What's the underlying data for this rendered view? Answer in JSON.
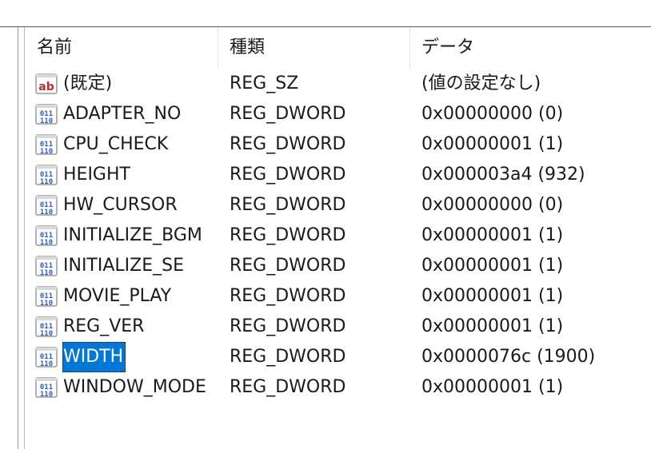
{
  "columns": {
    "name": "名前",
    "type": "種類",
    "data": "データ"
  },
  "rows": [
    {
      "icon": "string-value-icon",
      "name": "(既定)",
      "type": "REG_SZ",
      "data": "(値の設定なし)",
      "selected": false
    },
    {
      "icon": "binary-value-icon",
      "name": "ADAPTER_NO",
      "type": "REG_DWORD",
      "data": "0x00000000 (0)",
      "selected": false
    },
    {
      "icon": "binary-value-icon",
      "name": "CPU_CHECK",
      "type": "REG_DWORD",
      "data": "0x00000001 (1)",
      "selected": false
    },
    {
      "icon": "binary-value-icon",
      "name": "HEIGHT",
      "type": "REG_DWORD",
      "data": "0x000003a4 (932)",
      "selected": false
    },
    {
      "icon": "binary-value-icon",
      "name": "HW_CURSOR",
      "type": "REG_DWORD",
      "data": "0x00000000 (0)",
      "selected": false
    },
    {
      "icon": "binary-value-icon",
      "name": "INITIALIZE_BGM",
      "type": "REG_DWORD",
      "data": "0x00000001 (1)",
      "selected": false
    },
    {
      "icon": "binary-value-icon",
      "name": "INITIALIZE_SE",
      "type": "REG_DWORD",
      "data": "0x00000001 (1)",
      "selected": false
    },
    {
      "icon": "binary-value-icon",
      "name": "MOVIE_PLAY",
      "type": "REG_DWORD",
      "data": "0x00000001 (1)",
      "selected": false
    },
    {
      "icon": "binary-value-icon",
      "name": "REG_VER",
      "type": "REG_DWORD",
      "data": "0x00000001 (1)",
      "selected": false
    },
    {
      "icon": "binary-value-icon",
      "name": "WIDTH",
      "type": "REG_DWORD",
      "data": "0x0000076c (1900)",
      "selected": true
    },
    {
      "icon": "binary-value-icon",
      "name": "WINDOW_MODE",
      "type": "REG_DWORD",
      "data": "0x00000001 (1)",
      "selected": false
    }
  ],
  "colors": {
    "selection": "#0078d7",
    "text": "#1a1a1a",
    "icon_blue": "#2a5bd7",
    "icon_red": "#c62828"
  }
}
